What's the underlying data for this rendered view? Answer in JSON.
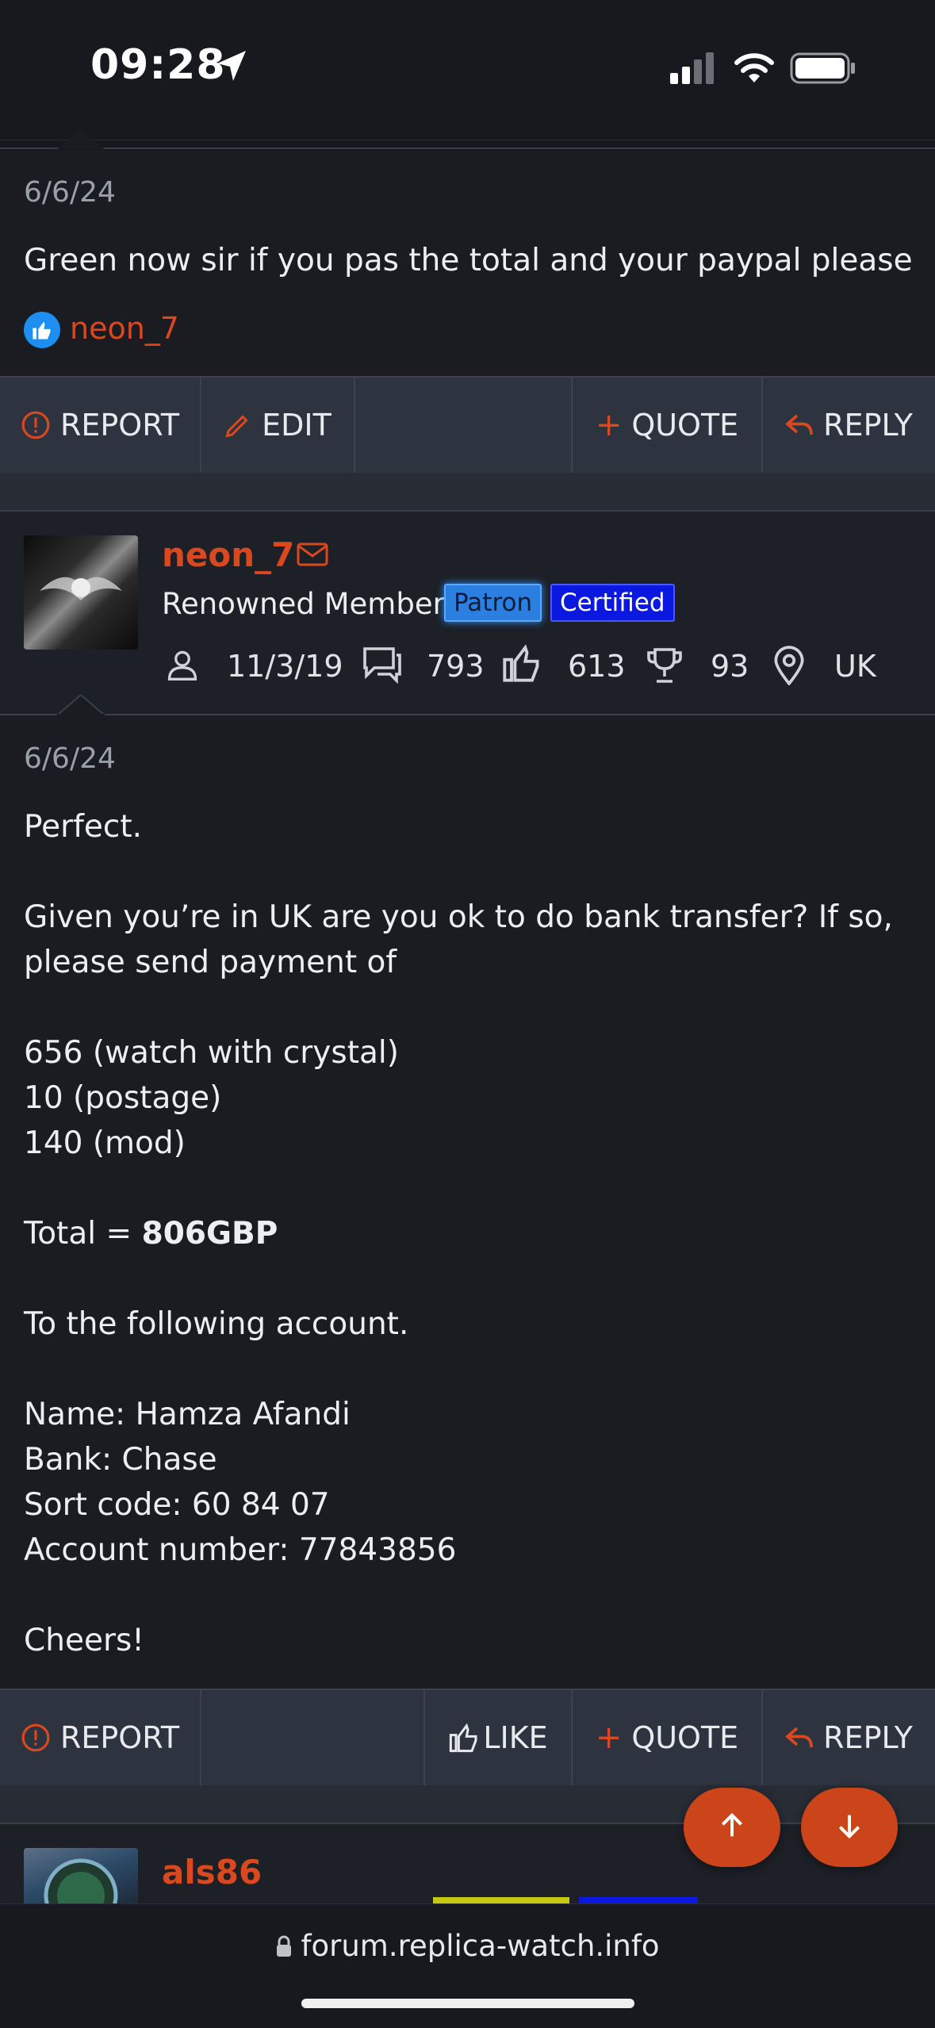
{
  "status": {
    "time": "09:28"
  },
  "post1": {
    "date": "6/6/24",
    "body": "Green now sir if you pas the total and your paypal please",
    "reaction_user": "neon_7"
  },
  "bar1": {
    "report": "REPORT",
    "edit": "EDIT",
    "quote": "QUOTE",
    "reply": "REPLY"
  },
  "user2": {
    "name": "neon_7",
    "title": "Renowned Member",
    "badge1": "Patron",
    "badge2": "Certified",
    "joined": "11/3/19",
    "messages": "793",
    "reactions": "613",
    "points": "93",
    "location": "UK"
  },
  "post2": {
    "date": "6/6/24",
    "lines": {
      "l1": "Perfect.",
      "l2": "Given you’re in UK are you ok to do bank transfer? If so,",
      "l3": "please send payment of",
      "l4": "656 (watch with crystal)",
      "l5": "10 (postage)",
      "l6": "140 (mod)",
      "total_prefix": "Total = ",
      "total_value": "806GBP",
      "l8": "To the following account.",
      "l9": "Name: Hamza Afandi",
      "l10": "Bank: Chase",
      "l11": "Sort code: 60 84 07",
      "l12": "Account number: 77843856",
      "l13": "Cheers!"
    }
  },
  "bar2": {
    "report": "REPORT",
    "like": "LIKE",
    "quote": "QUOTE",
    "reply": "REPLY"
  },
  "user3": {
    "name": "als86"
  },
  "browser": {
    "url": "forum.replica-watch.info"
  },
  "colors": {
    "accent": "#d9481f",
    "patron": "#2b7fe0",
    "certified": "#0b18e0"
  }
}
